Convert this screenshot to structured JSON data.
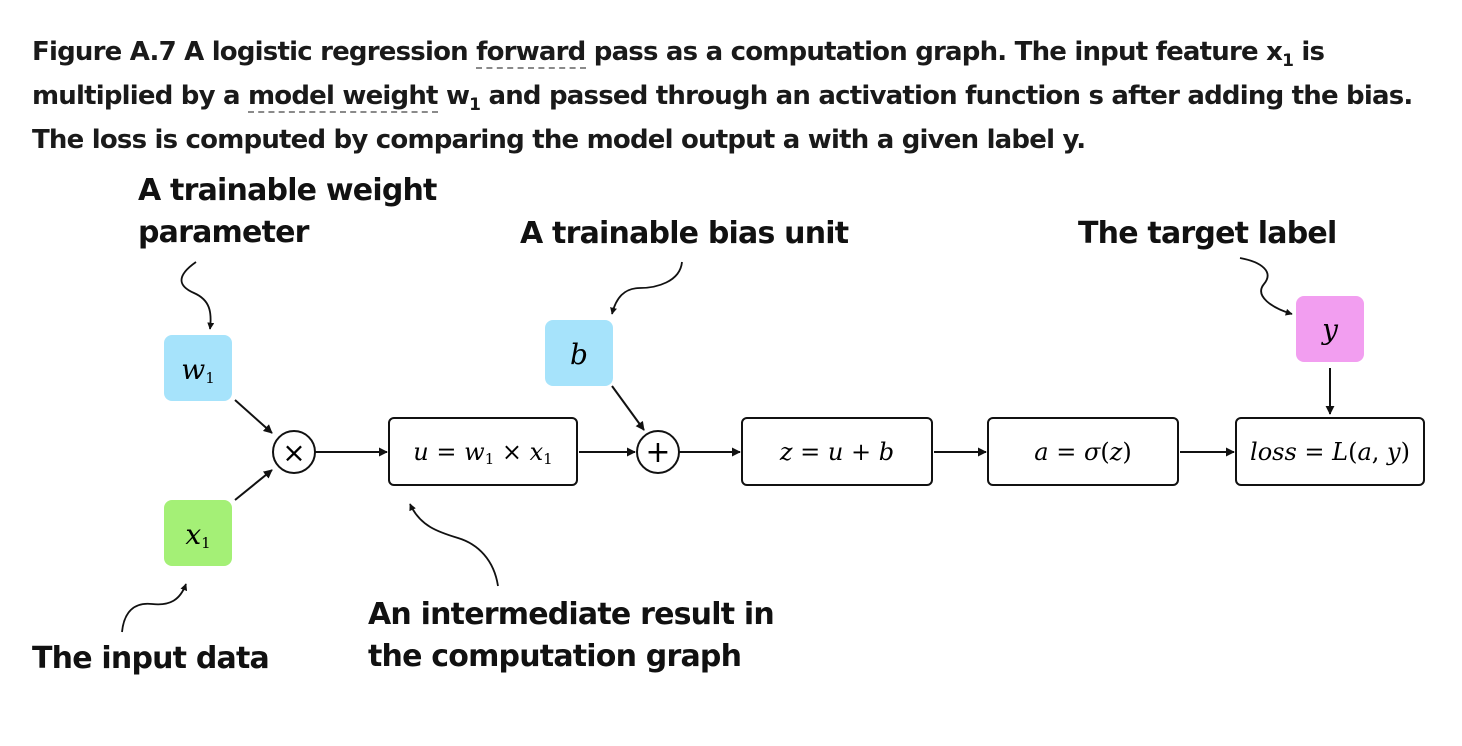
{
  "caption": {
    "part1": "Figure A.7   A logistic regression ",
    "link1": "forward",
    "part2": " pass as a computation graph. The input feature x",
    "sub1": "1",
    "part3": " is multiplied by a ",
    "link2": "model weight",
    "part4": " w",
    "sub2": "1",
    "part5": " and passed through an activation function s after adding the bias. The loss is computed by comparing the model output a with a given label y."
  },
  "annotations": {
    "weight_line1": "A trainable weight",
    "weight_line2": "parameter",
    "bias": "A trainable bias unit",
    "target": "The target label",
    "input": "The input data",
    "intermediate_line1": "An intermediate result in",
    "intermediate_line2": "the computation graph"
  },
  "nodes": {
    "w1": {
      "var": "w",
      "sub": "1",
      "color": "#a6e3fb"
    },
    "x1": {
      "var": "x",
      "sub": "1",
      "color": "#a4f076"
    },
    "b": {
      "var": "b",
      "color": "#a6e3fb"
    },
    "y": {
      "var": "y",
      "color": "#f29ef0"
    },
    "multiply_symbol": "×",
    "add_symbol": "+"
  },
  "boxes": {
    "u": {
      "p1": "u",
      "p2": " = ",
      "p3": "w",
      "p3sub": "1",
      "p4": " × ",
      "p5": "x",
      "p5sub": "1"
    },
    "z": {
      "p1": "z",
      "p2": " = ",
      "p3": "u",
      "p4": " + ",
      "p5": "b"
    },
    "a": {
      "p1": "a",
      "p2": " = ",
      "p3": "σ",
      "p4": "(",
      "p5": "z",
      "p6": ")"
    },
    "loss": {
      "p1": "loss",
      "p2": " = ",
      "p3": "L",
      "p4": "(",
      "p5": "a",
      "p6": ", ",
      "p7": "y",
      "p8": ")"
    }
  }
}
